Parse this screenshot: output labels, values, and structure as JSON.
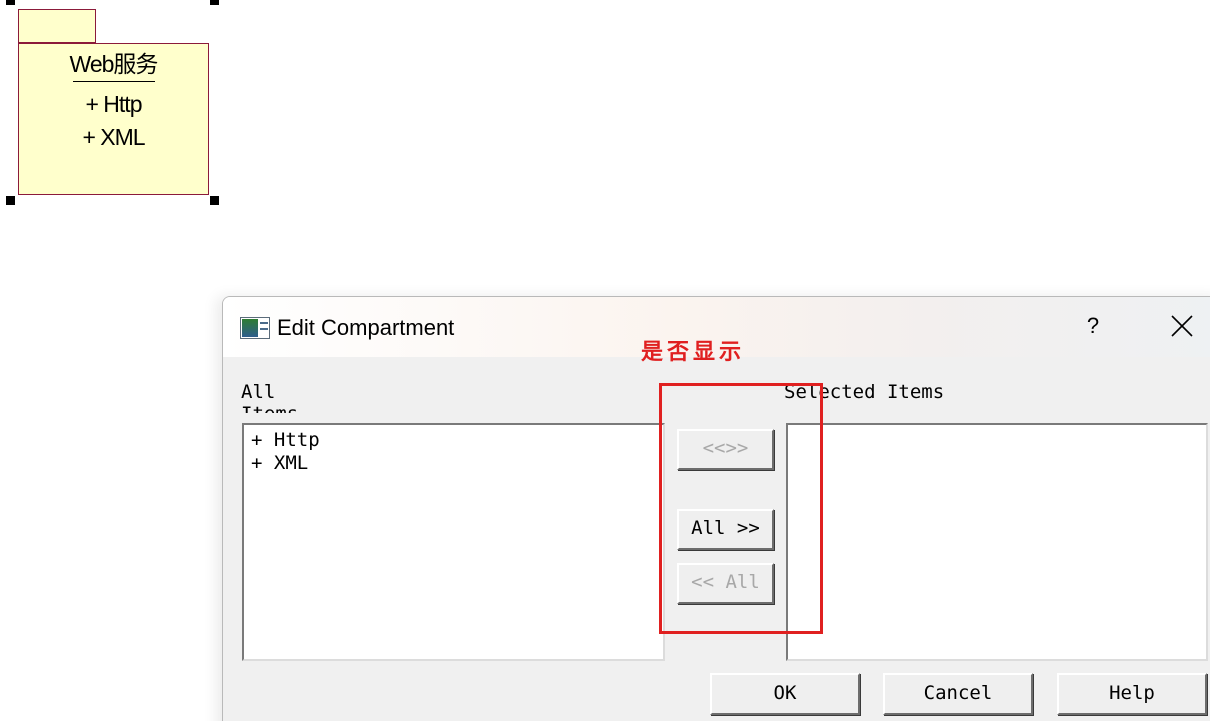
{
  "canvas": {
    "package": {
      "name": "Web服务",
      "members": [
        "+ Http",
        "+ XML"
      ]
    }
  },
  "dialog": {
    "title": "Edit Compartment",
    "help_label": "?",
    "all_items_label_line1": "All",
    "all_items_label_line2": "Items",
    "selected_items_label": "Selected Items",
    "all_items": [
      "+ Http",
      "+ XML"
    ],
    "selected_items": [],
    "buttons": {
      "toggle": "<<>>",
      "add_all": "All >>",
      "remove_all": "<< All",
      "ok": "OK",
      "cancel": "Cancel",
      "help": "Help"
    },
    "annotation": "是否显示"
  },
  "colors": {
    "package_fill": "#ffffcc",
    "package_border": "#8b1a3a",
    "annotation": "#e02020"
  }
}
